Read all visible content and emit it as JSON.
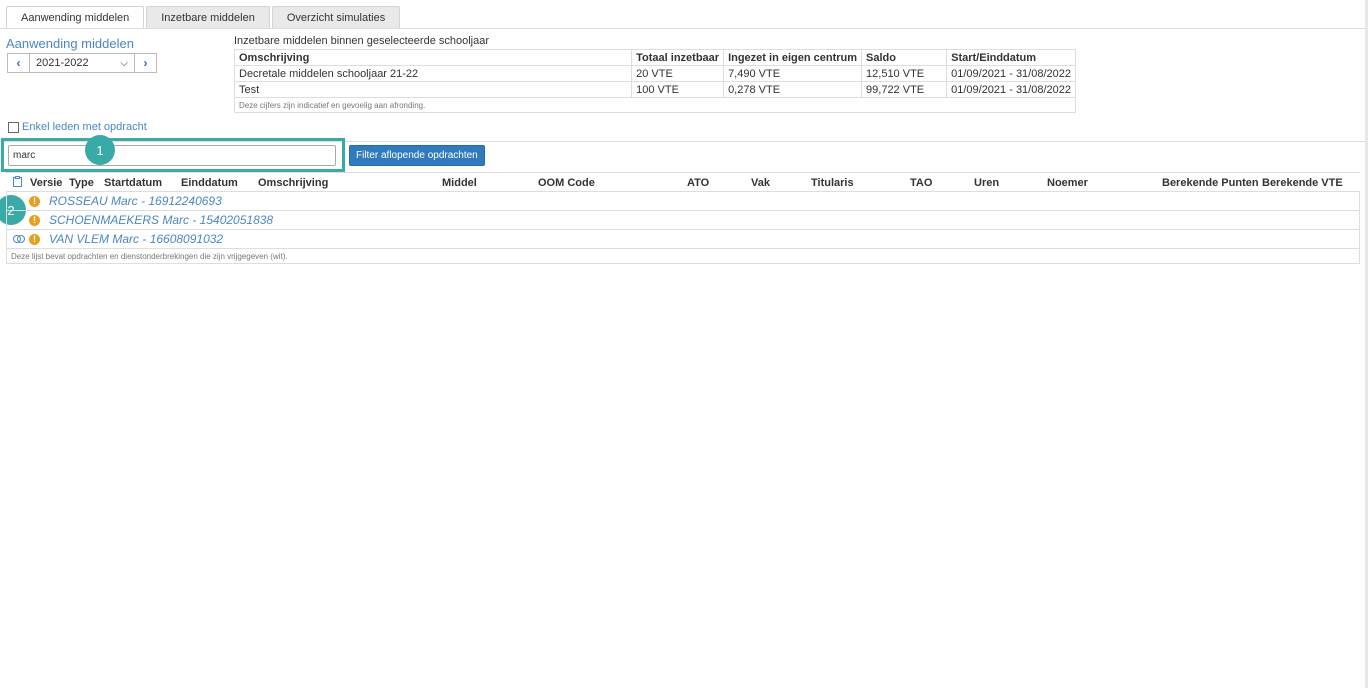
{
  "tabs": [
    {
      "label": "Aanwending middelen",
      "active": true
    },
    {
      "label": "Inzetbare middelen",
      "active": false
    },
    {
      "label": "Overzicht simulaties",
      "active": false
    }
  ],
  "page_title": "Aanwending middelen",
  "year_selector": {
    "value": "2021-2022",
    "prev_icon": "chevron-left",
    "next_icon": "chevron-right"
  },
  "summary": {
    "title": "Inzetbare middelen binnen geselecteerde schooljaar",
    "columns": [
      "Omschrijving",
      "Totaal inzetbaar",
      "Ingezet in eigen centrum",
      "Saldo",
      "Start/Einddatum"
    ],
    "rows": [
      [
        "Decretale middelen schooljaar 21-22",
        "20 VTE",
        "7,490 VTE",
        "12,510 VTE",
        "01/09/2021 - 31/08/2022"
      ],
      [
        "Test",
        "100 VTE",
        "0,278 VTE",
        "99,722 VTE",
        "01/09/2021 - 31/08/2022"
      ]
    ],
    "note": "Deze cijfers zijn indicatief en gevoelig aan afronding."
  },
  "only_members_label": "Enkel leden met opdracht",
  "search": {
    "value": "marc",
    "placeholder": ""
  },
  "filter_button_label": "Filter aflopende opdrachten",
  "badges": [
    "1",
    "2"
  ],
  "grid": {
    "columns": [
      "Versie",
      "Type",
      "Startdatum",
      "Einddatum",
      "Omschrijving",
      "Middel",
      "OOM Code",
      "ATO",
      "Vak",
      "Titularis",
      "TAO",
      "Uren",
      "Noemer",
      "Berekende Punten",
      "Berekende VTE"
    ],
    "rows": [
      {
        "name": "ROSSEAU Marc - 16912240693",
        "linked": false
      },
      {
        "name": "SCHOENMAEKERS Marc - 15402051838",
        "linked": false
      },
      {
        "name": "VAN VLEM Marc - 16608091032",
        "linked": true
      }
    ],
    "note": "Deze lijst bevat opdrachten en dienstonderbrekingen die zijn vrijgegeven (wit)."
  },
  "colors": {
    "accent": "#4a87c5",
    "button": "#2f7bbd",
    "highlight": "#3aaaa7",
    "warning": "#e6a01f"
  }
}
